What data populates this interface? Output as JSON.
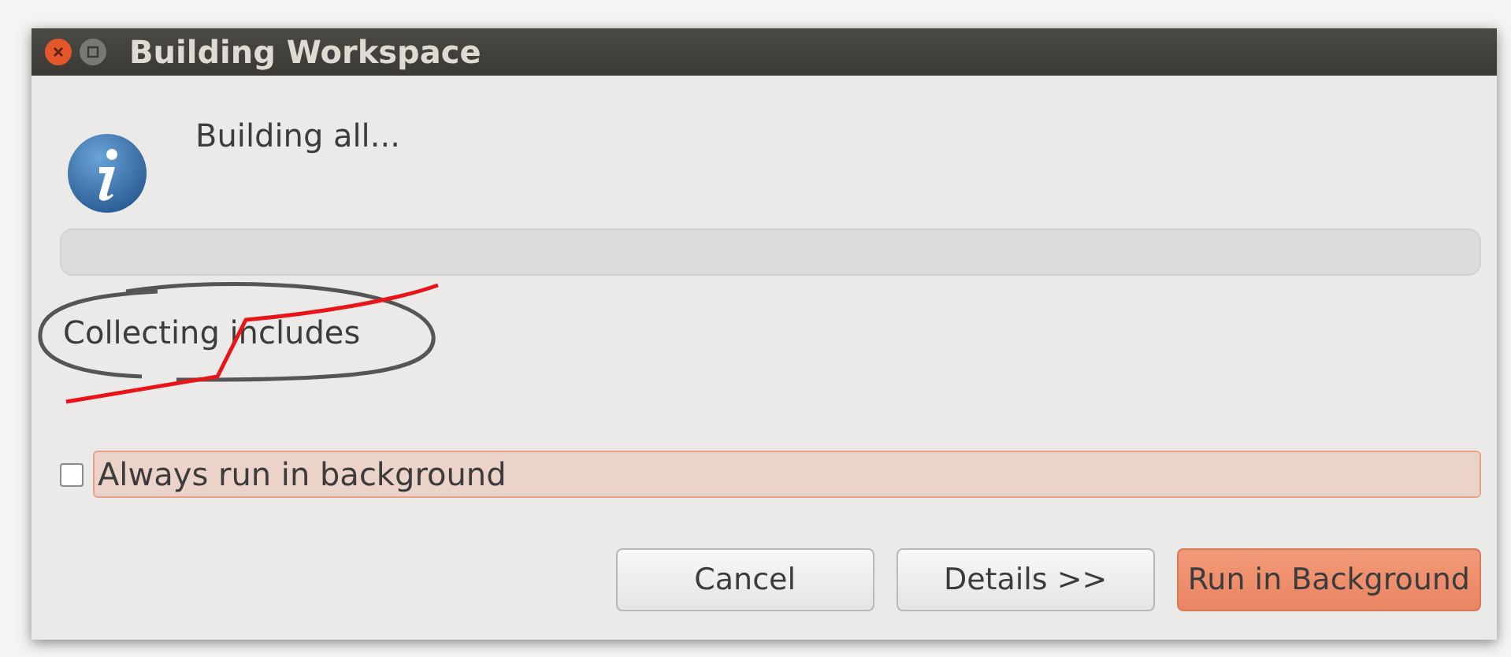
{
  "window": {
    "title": "Building Workspace"
  },
  "message": "Building all...",
  "progress": {
    "level": 0
  },
  "status": "Collecting includes",
  "always_run_in_background": {
    "label": "Always run in background",
    "checked": false
  },
  "buttons": [
    {
      "label": "Cancel",
      "kind": "normal"
    },
    {
      "label": "Details >>",
      "kind": "normal"
    },
    {
      "label": "Run in Background",
      "kind": "default"
    }
  ]
}
